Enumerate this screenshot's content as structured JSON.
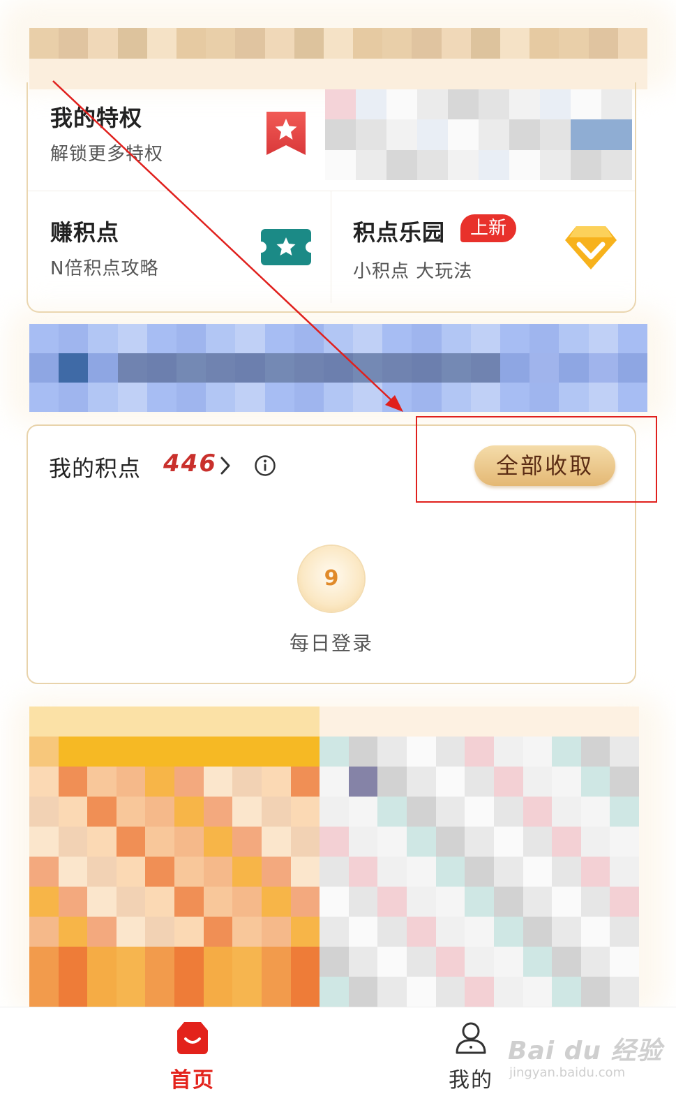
{
  "perks": {
    "privilege": {
      "title": "我的特权",
      "subtitle": "解锁更多特权",
      "icon": "ribbon-star-icon"
    },
    "earn_points": {
      "title": "赚积点",
      "subtitle": "N倍积点攻略",
      "icon": "ticket-star-icon"
    },
    "points_park": {
      "title": "积点乐园",
      "badge": "上新",
      "subtitle": "小积点 大玩法",
      "icon": "diamond-icon"
    }
  },
  "points": {
    "label": "我的积点",
    "value": "446",
    "chevron": "›",
    "collect_all_label": "全部收取",
    "daily_login": {
      "coin_value": "9",
      "label": "每日登录"
    }
  },
  "bottom_nav": {
    "home_label": "首页",
    "mine_label": "我的"
  },
  "watermark": {
    "main": "Bai du 经验",
    "sub": "jingyan.baidu.com"
  },
  "colors": {
    "accent_red": "#e3221b",
    "points_value": "#c9302c",
    "collect_button": "#e4b874",
    "card_border": "#e8d3ab",
    "highlight": "#e0201d"
  }
}
